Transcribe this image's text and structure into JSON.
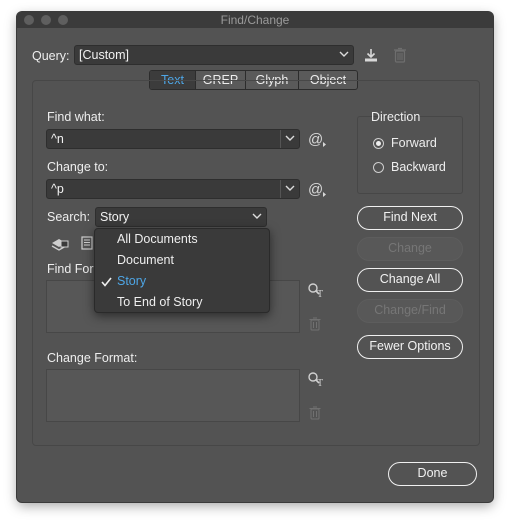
{
  "window": {
    "title": "Find/Change"
  },
  "query": {
    "label": "Query:",
    "value": "[Custom]"
  },
  "tabs": [
    {
      "label": "Text",
      "active": true
    },
    {
      "label": "GREP",
      "active": false
    },
    {
      "label": "Glyph",
      "active": false
    },
    {
      "label": "Object",
      "active": false
    }
  ],
  "find": {
    "label": "Find what:",
    "value": "^n"
  },
  "change": {
    "label": "Change to:",
    "value": "^p"
  },
  "search": {
    "label": "Search:",
    "value": "Story",
    "options": [
      "All Documents",
      "Document",
      "Story",
      "To End of Story"
    ],
    "selected_index": 2
  },
  "find_format": {
    "label": "Find For"
  },
  "change_format": {
    "label": "Change Format:"
  },
  "direction": {
    "label": "Direction",
    "options": [
      {
        "label": "Forward",
        "selected": true
      },
      {
        "label": "Backward",
        "selected": false
      }
    ]
  },
  "buttons": {
    "find_next": "Find Next",
    "change": "Change",
    "change_all": "Change All",
    "change_find": "Change/Find",
    "fewer_options": "Fewer Options",
    "done": "Done"
  },
  "colors": {
    "background": "#535353",
    "accent": "#4ea6e6",
    "field": "#3a3a3a"
  },
  "icons": [
    "save-query-icon",
    "delete-query-icon",
    "special-characters-icon",
    "lock-layers-icon",
    "lock-stories-icon",
    "specify-format-icon",
    "clear-format-icon",
    "checkmark-icon",
    "chevron-down-icon"
  ]
}
